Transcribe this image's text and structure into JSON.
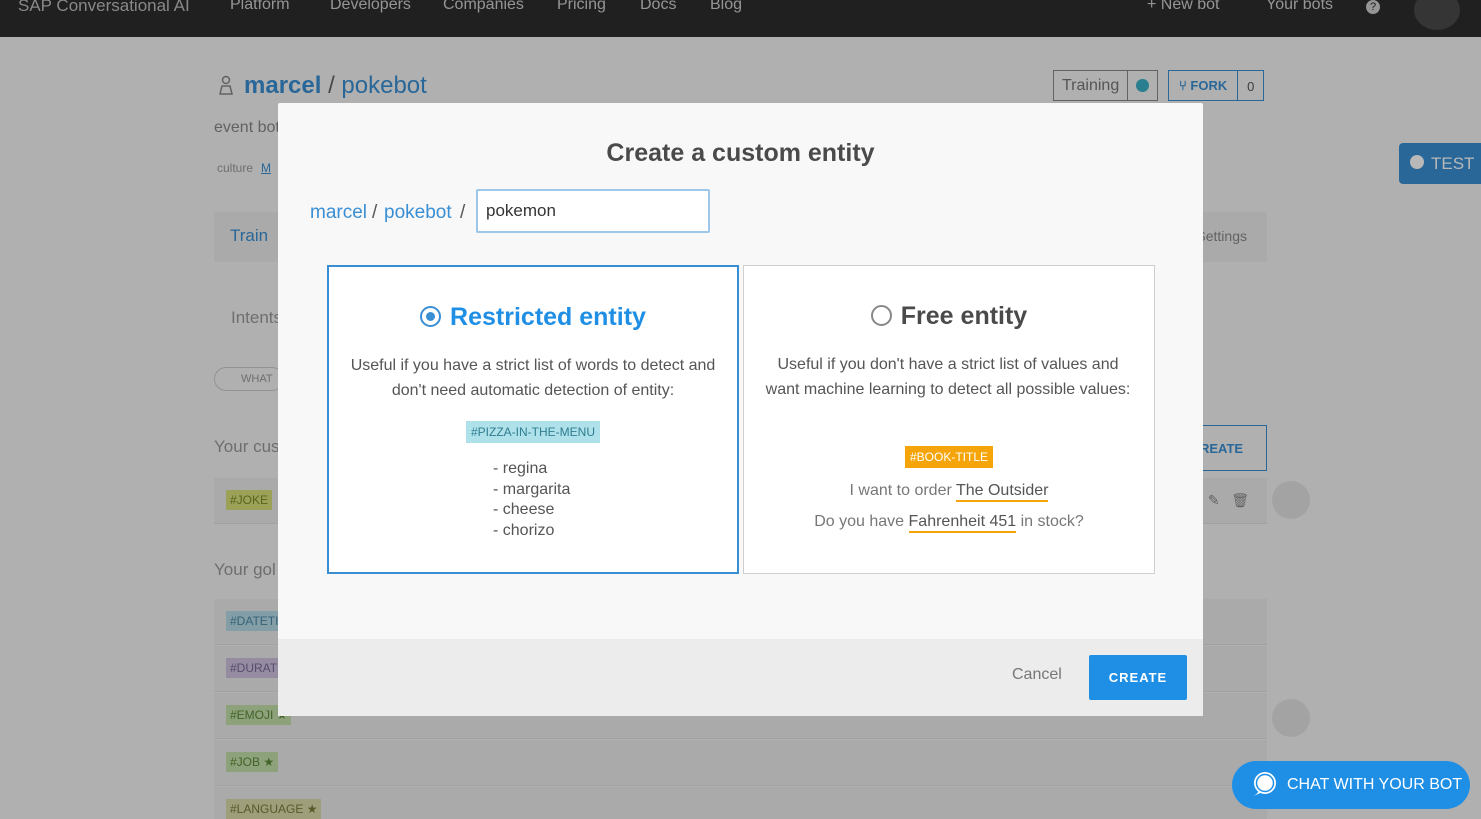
{
  "nav": {
    "brand": "SAP Conversational AI",
    "links": [
      "Platform",
      "Developers",
      "Companies",
      "Pricing",
      "Docs",
      "Blog"
    ],
    "new_bot": "New bot",
    "your_bots": "Your bots",
    "help": "?"
  },
  "bot": {
    "owner": "marcel",
    "separator": "/",
    "name": "pokebot",
    "description": "event bot",
    "culture_label": "culture",
    "culture_link": "M",
    "status": "Training",
    "fork_label": "FORK",
    "fork_count": "0",
    "test_label": "TEST"
  },
  "tabs": {
    "train": "Train",
    "settings": "Settings",
    "intents": "Intents",
    "search_pill": "WHAT"
  },
  "sections": {
    "custom": "Your cus",
    "gold": "Your gol",
    "create_button": "REATE"
  },
  "entity_tags": [
    "#JOKE",
    "#DATETI",
    "#DURATI",
    "#EMOJI  ★",
    "#JOB  ★",
    "#LANGUAGE  ★"
  ],
  "modal": {
    "title": "Create a custom entity",
    "breadcrumb_owner": "marcel",
    "breadcrumb_bot": "pokebot",
    "separator": "/",
    "entity_name_value": "pokemon",
    "restricted": {
      "title": "Restricted entity",
      "description": "Useful if you have a strict list of words to detect and don't need automatic detection of entity:",
      "tag": "#PIZZA-IN-THE-MENU",
      "items": [
        "- regina",
        "- margarita",
        "- cheese",
        "- chorizo"
      ],
      "selected": true
    },
    "free": {
      "title": "Free entity",
      "description": "Useful if you don't have a strict list of values and want machine learning to detect all possible values:",
      "tag": "#BOOK-TITLE",
      "sentence1_prefix": "I want to order ",
      "sentence1_highlight": "The Outsider",
      "sentence2_prefix": "Do you have ",
      "sentence2_highlight": "Fahrenheit 451",
      "sentence2_suffix": " in stock?",
      "selected": false
    },
    "cancel_label": "Cancel",
    "create_label": "CREATE"
  },
  "chat": {
    "label": "CHAT WITH YOUR BOT"
  },
  "colors": {
    "accent": "#1f8fe5",
    "link": "#3a8fd4",
    "book_tag": "#f5a50a",
    "pizza_tag": "#aee1ea",
    "nav_bg": "#2d2d2d"
  }
}
